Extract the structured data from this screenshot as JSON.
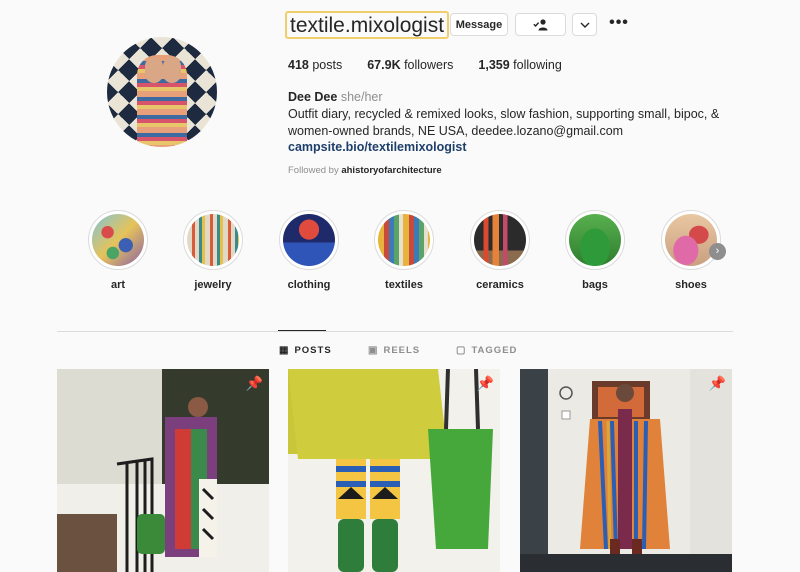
{
  "profile": {
    "username": "textile.mixologist",
    "message_label": "Message",
    "more_label": "•••",
    "posts_count": "418",
    "posts_label": "posts",
    "followers_count": "67.9K",
    "followers_label": "followers",
    "following_count": "1,359",
    "following_label": "following",
    "display_name": "Dee Dee",
    "pronouns": "she/her",
    "bio": "Outfit diary, recycled & remixed looks, slow fashion, supporting small, bipoc, & women-owned brands, NE USA, deedee.lozano@gmail.com",
    "link": "campsite.bio/textilemixologist",
    "followed_by_prefix": "Followed by",
    "followed_by_user": "ahistoryofarchitecture"
  },
  "highlights": [
    {
      "label": "art"
    },
    {
      "label": "jewelry"
    },
    {
      "label": "clothing"
    },
    {
      "label": "textiles"
    },
    {
      "label": "ceramics"
    },
    {
      "label": "bags"
    },
    {
      "label": "shoes"
    }
  ],
  "tabs": [
    {
      "label": "POSTS",
      "icon": "grid-icon"
    },
    {
      "label": "REELS",
      "icon": "reels-icon"
    },
    {
      "label": "TAGGED",
      "icon": "tagged-icon"
    }
  ],
  "colors": {
    "background": "#fafafa",
    "text": "#262626",
    "muted": "#8e8e8e",
    "link": "#1f3f6b",
    "border": "#dbdbdb",
    "username_highlight": "#f0cf6a"
  }
}
